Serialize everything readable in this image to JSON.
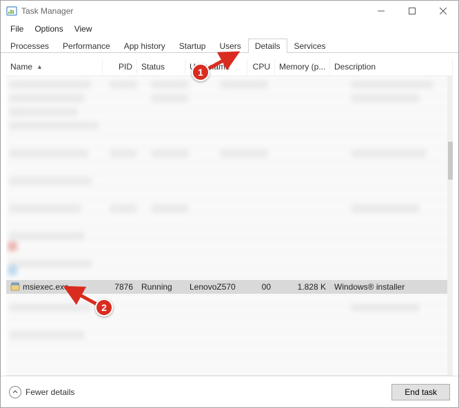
{
  "window": {
    "title": "Task Manager"
  },
  "menu": {
    "file": "File",
    "options": "Options",
    "view": "View"
  },
  "tabs": {
    "processes": "Processes",
    "performance": "Performance",
    "app_history": "App history",
    "startup": "Startup",
    "users": "Users",
    "details": "Details",
    "services": "Services"
  },
  "columns": {
    "name": "Name",
    "pid": "PID",
    "status": "Status",
    "user": "User name",
    "cpu": "CPU",
    "memory": "Memory (p...",
    "description": "Description"
  },
  "selected_row": {
    "name": "msiexec.exe",
    "pid": "7876",
    "status": "Running",
    "user": "LenovoZ570",
    "cpu": "00",
    "memory": "1.828 K",
    "description": "Windows® installer"
  },
  "footer": {
    "fewer_details": "Fewer details",
    "end_task": "End task"
  },
  "callouts": {
    "one": "1",
    "two": "2"
  }
}
